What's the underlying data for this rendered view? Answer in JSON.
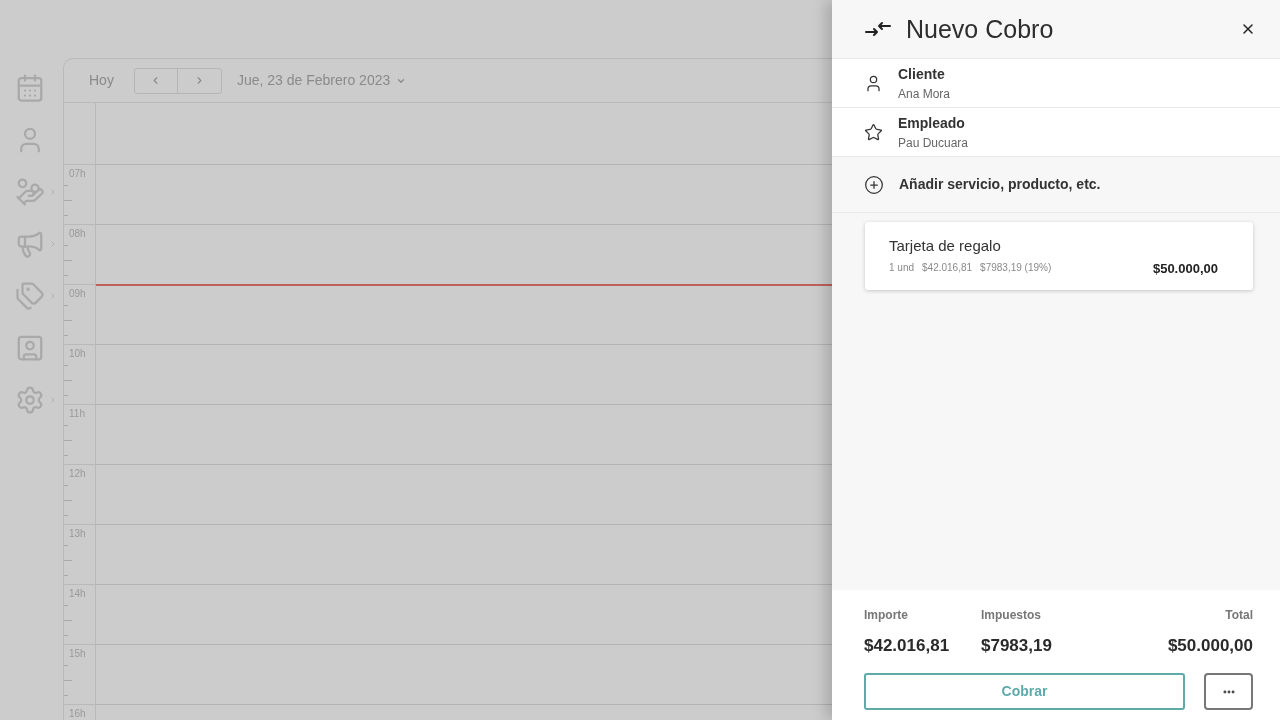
{
  "sidebar": {
    "items": [
      {
        "has_submenu": false
      },
      {
        "has_submenu": false
      },
      {
        "has_submenu": true
      },
      {
        "has_submenu": true
      },
      {
        "has_submenu": true
      },
      {
        "has_submenu": false
      },
      {
        "has_submenu": true
      }
    ]
  },
  "calendar": {
    "today_button": "Hoy",
    "date_label": "Jue, 23 de Febrero 2023",
    "hours": [
      {
        "label": "07h",
        "now": false
      },
      {
        "label": "08h",
        "now": false
      },
      {
        "label": "09h",
        "now": true
      },
      {
        "label": "10h",
        "now": false
      },
      {
        "label": "11h",
        "now": false
      },
      {
        "label": "12h",
        "now": false
      },
      {
        "label": "13h",
        "now": false
      },
      {
        "label": "14h",
        "now": false
      },
      {
        "label": "15h",
        "now": false
      },
      {
        "label": "16h",
        "now": false
      }
    ]
  },
  "drawer": {
    "title": "Nuevo Cobro",
    "fields": [
      {
        "label": "Cliente",
        "value": "Ana Mora"
      },
      {
        "label": "Empleado",
        "value": "Pau Ducuara"
      }
    ],
    "add_item": "Añadir servicio, producto, etc.",
    "items": [
      {
        "name": "Tarjeta de regalo",
        "quantity": "1 und",
        "net": "$42.016,81",
        "tax": "$7983,19 (19%)",
        "price": "$50.000,00"
      }
    ],
    "summary": [
      {
        "label": "Importe",
        "value": "$42.016,81"
      },
      {
        "label": "Impuestos",
        "value": "$7983,19"
      },
      {
        "label": "Total",
        "value": "$50.000,00"
      }
    ],
    "charge_button": "Cobrar"
  }
}
